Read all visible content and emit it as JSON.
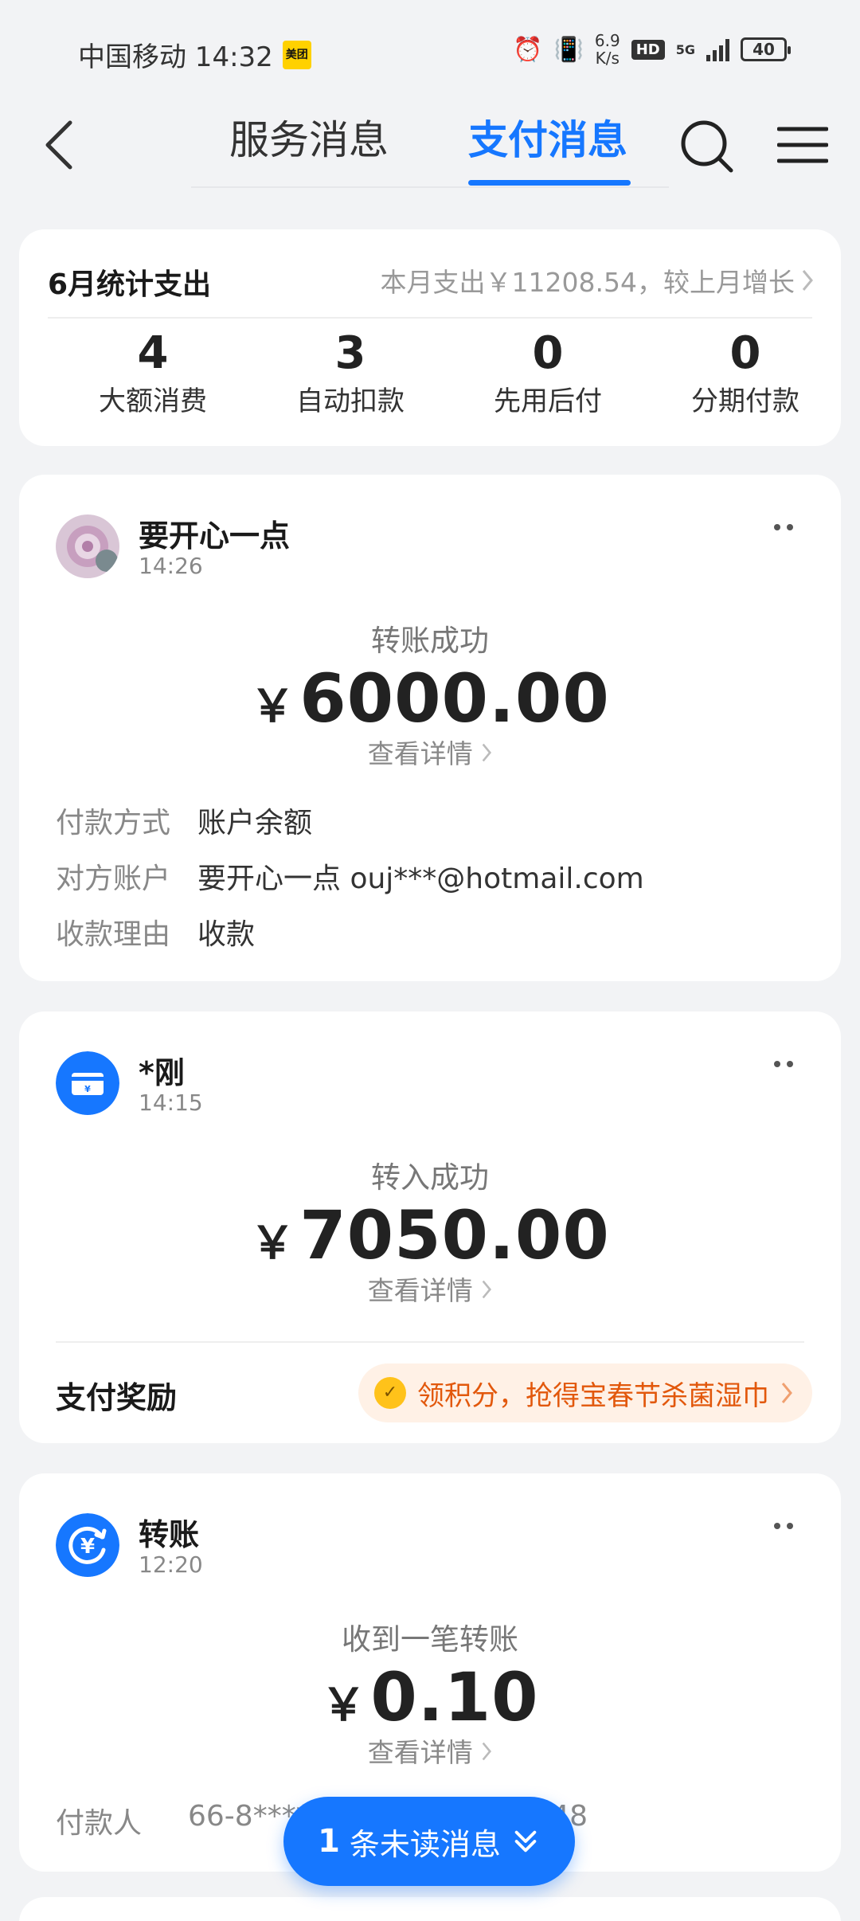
{
  "status_bar": {
    "carrier_time": "中国移动 14:32",
    "app_badge": "美团",
    "speed_value": "6.9",
    "speed_unit": "K/s",
    "hd_label": "HD",
    "network": "5G",
    "battery": "40"
  },
  "header": {
    "tabs": [
      {
        "label": "服务消息",
        "active": false
      },
      {
        "label": "支付消息",
        "active": true
      }
    ],
    "accent_color": "#1677ff"
  },
  "summary": {
    "title": "6月统计支出",
    "month_text": "本月支出￥11208.54，较上月增长",
    "stats": [
      {
        "count": "4",
        "label": "大额消费"
      },
      {
        "count": "3",
        "label": "自动扣款"
      },
      {
        "count": "0",
        "label": "先用后付"
      },
      {
        "count": "0",
        "label": "分期付款"
      }
    ]
  },
  "messages": [
    {
      "name": "要开心一点",
      "time": "14:26",
      "status": "转账成功",
      "currency": "￥",
      "amount": "6000.00",
      "detail_link": "查看详情",
      "info": [
        {
          "key": "付款方式",
          "value": "账户余额"
        },
        {
          "key": "对方账户",
          "value": "要开心一点 ouj***@hotmail.com"
        },
        {
          "key": "收款理由",
          "value": "收款"
        }
      ]
    },
    {
      "name": "*刚",
      "time": "14:15",
      "status": "转入成功",
      "currency": "￥",
      "amount": "7050.00",
      "detail_link": "查看详情",
      "reward_label": "支付奖励",
      "reward_text": "领积分，抢得宝春节杀菌湿巾"
    },
    {
      "name": "转账",
      "time": "12:20",
      "status": "收到一笔转账",
      "currency": "￥",
      "amount": "0.10",
      "detail_link": "查看详情",
      "info": [
        {
          "key": "付款人",
          "value": "66-8****1648 66-8****1648"
        }
      ]
    }
  ],
  "unread": {
    "count": "1",
    "text": "条未读消息"
  }
}
